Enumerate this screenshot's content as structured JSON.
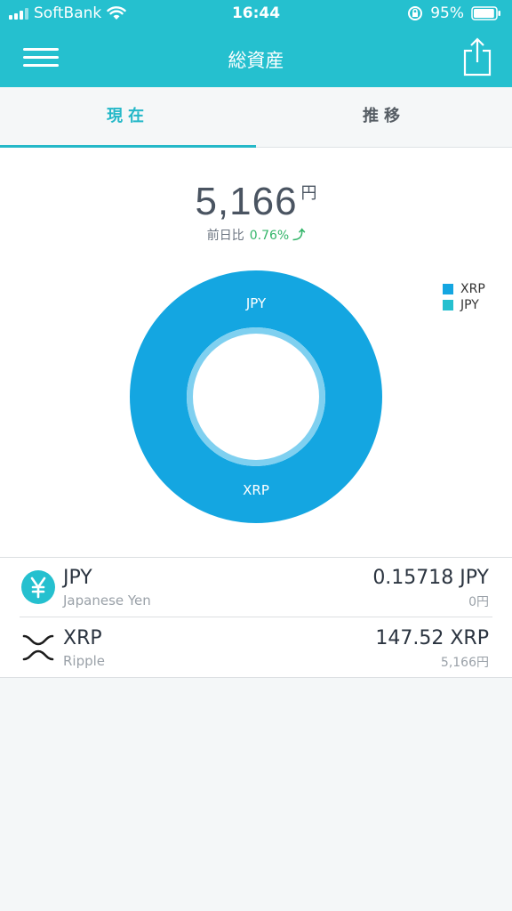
{
  "status_bar": {
    "carrier": "SoftBank",
    "time": "16:44",
    "battery": "95%",
    "battery_level": 0.95
  },
  "nav": {
    "title": "総資産"
  },
  "tabs": [
    {
      "label": "現在",
      "active": true
    },
    {
      "label": "推移",
      "active": false
    }
  ],
  "summary": {
    "total": "5,166",
    "unit": "円",
    "change_label": "前日比",
    "change_pct": "0.76%",
    "change_arrow": "⤴"
  },
  "colors": {
    "header": "#25c0cf",
    "xrp": "#14a6e1",
    "jpy": "#25c0cf",
    "positive": "#34b56a"
  },
  "chart_data": {
    "type": "pie",
    "categories": [
      "XRP",
      "JPY"
    ],
    "values": [
      5166,
      0
    ],
    "legend_position": "top-right",
    "slice_labels": [
      "JPY",
      "XRP"
    ]
  },
  "legend": [
    "XRP",
    "JPY"
  ],
  "assets": [
    {
      "symbol": "JPY",
      "name": "Japanese Yen",
      "amount": "0.15718 JPY",
      "value": "0円",
      "icon": "yen-icon"
    },
    {
      "symbol": "XRP",
      "name": "Ripple",
      "amount": "147.52 XRP",
      "value": "5,166円",
      "icon": "xrp-icon"
    }
  ]
}
